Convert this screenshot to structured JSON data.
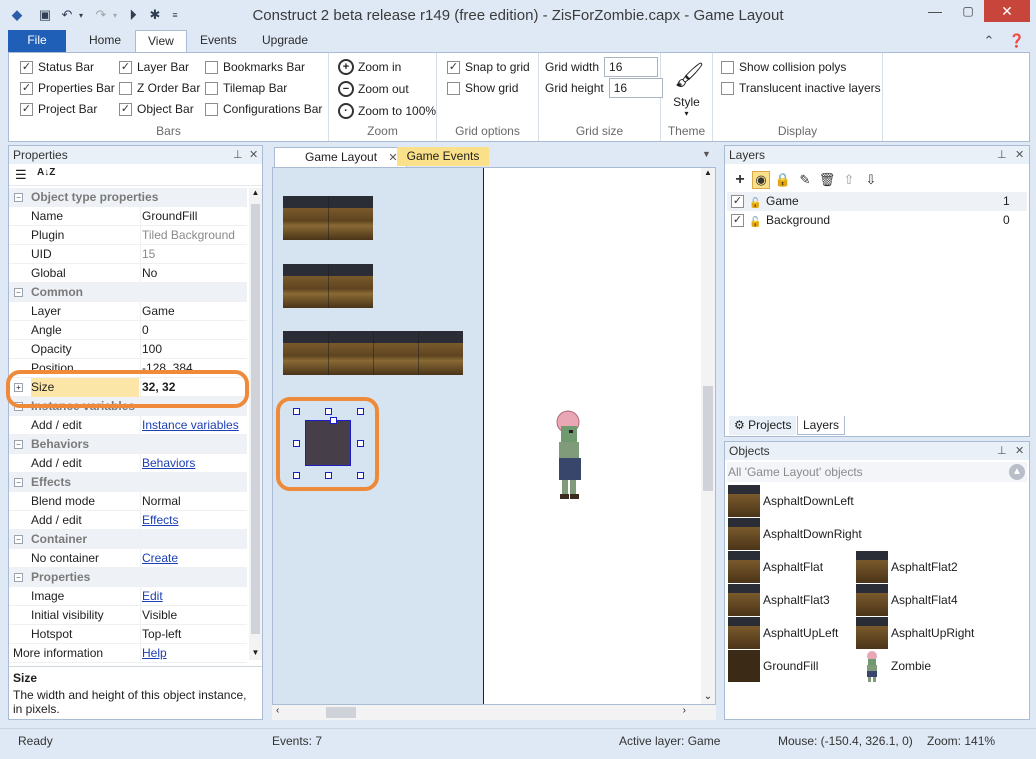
{
  "window": {
    "title": "Construct 2 beta release r149  (free edition) - ZisForZombie.capx - Game Layout",
    "min": "—",
    "max": "▢",
    "close": "✕"
  },
  "quick_access": {
    "icons": [
      "app-icon",
      "save-icon",
      "undo-icon",
      "redo-icon",
      "run-icon",
      "debug-icon",
      "customize-icon"
    ]
  },
  "ribbon_tabs": [
    "File",
    "Home",
    "View",
    "Events",
    "Upgrade"
  ],
  "ribbon": {
    "bars": {
      "label": "Bars",
      "items": [
        {
          "label": "Status Bar",
          "checked": true
        },
        {
          "label": "Properties Bar",
          "checked": true
        },
        {
          "label": "Project Bar",
          "checked": true
        },
        {
          "label": "Layer Bar",
          "checked": true
        },
        {
          "label": "Z Order Bar",
          "checked": false
        },
        {
          "label": "Object Bar",
          "checked": true
        },
        {
          "label": "Bookmarks Bar",
          "checked": false
        },
        {
          "label": "Tilemap Bar",
          "checked": false
        },
        {
          "label": "Configurations Bar",
          "checked": false
        }
      ]
    },
    "zoom": {
      "label": "Zoom",
      "zoom_in": "Zoom in",
      "zoom_out": "Zoom out",
      "zoom_100": "Zoom to 100%"
    },
    "grid_options": {
      "label": "Grid options",
      "snap": "Snap to grid",
      "snap_checked": true,
      "show": "Show grid",
      "show_checked": false
    },
    "grid_size": {
      "label": "Grid size",
      "width_label": "Grid width",
      "width": "16",
      "height_label": "Grid height",
      "height": "16"
    },
    "theme": {
      "label": "Theme",
      "style": "Style"
    },
    "display": {
      "label": "Display",
      "collision": "Show collision polys",
      "translucent": "Translucent inactive layers"
    }
  },
  "properties": {
    "title": "Properties",
    "rows": [
      {
        "type": "cat",
        "k": "Object type properties"
      },
      {
        "type": "row",
        "k": "Name",
        "v": "GroundFill"
      },
      {
        "type": "row",
        "k": "Plugin",
        "v": "Tiled Background",
        "gray": true
      },
      {
        "type": "row",
        "k": "UID",
        "v": "15",
        "gray": true
      },
      {
        "type": "row",
        "k": "Global",
        "v": "No"
      },
      {
        "type": "cat",
        "k": "Common"
      },
      {
        "type": "row",
        "k": "Layer",
        "v": "Game"
      },
      {
        "type": "row",
        "k": "Angle",
        "v": "0"
      },
      {
        "type": "row",
        "k": "Opacity",
        "v": "100"
      },
      {
        "type": "row",
        "k": "Position",
        "v": "-128, 384"
      },
      {
        "type": "sel",
        "k": "Size",
        "v": "32, 32"
      },
      {
        "type": "cat",
        "k": "Instance variables"
      },
      {
        "type": "row",
        "k": "Add / edit",
        "v": "Instance variables",
        "link": true
      },
      {
        "type": "cat",
        "k": "Behaviors"
      },
      {
        "type": "row",
        "k": "Add / edit",
        "v": "Behaviors",
        "link": true
      },
      {
        "type": "cat",
        "k": "Effects"
      },
      {
        "type": "row",
        "k": "Blend mode",
        "v": "Normal"
      },
      {
        "type": "row",
        "k": "Add / edit",
        "v": "Effects",
        "link": true
      },
      {
        "type": "cat",
        "k": "Container"
      },
      {
        "type": "row",
        "k": "No container",
        "v": "Create",
        "link": true
      },
      {
        "type": "cat",
        "k": "Properties"
      },
      {
        "type": "row",
        "k": "Image",
        "v": "Edit",
        "link": true
      },
      {
        "type": "row",
        "k": "Initial visibility",
        "v": "Visible"
      },
      {
        "type": "row",
        "k": "Hotspot",
        "v": "Top-left"
      },
      {
        "type": "row",
        "k": "More information",
        "v": "Help",
        "link": true,
        "nokey": true
      }
    ],
    "desc_title": "Size",
    "desc_text": "The width and height of this object instance, in pixels."
  },
  "editor": {
    "tabs": [
      "Game Layout",
      "Game Events"
    ],
    "tab_close": "✕"
  },
  "layers": {
    "title": "Layers",
    "rows": [
      {
        "name": "Game",
        "num": "1",
        "checked": true
      },
      {
        "name": "Background",
        "num": "0",
        "checked": true
      }
    ],
    "bottom_tabs": [
      "Projects",
      "Layers"
    ]
  },
  "objects": {
    "title": "Objects",
    "filter": "All 'Game Layout' objects",
    "items": [
      "AsphaltDownLeft",
      "AsphaltDownRight",
      "AsphaltFlat",
      "AsphaltFlat2",
      "AsphaltFlat3",
      "AsphaltFlat4",
      "AsphaltUpLeft",
      "AsphaltUpRight",
      "GroundFill",
      "Zombie"
    ]
  },
  "status": {
    "ready": "Ready",
    "events": "Events: 7",
    "active_layer": "Active layer: Game",
    "mouse": "Mouse: (-150.4, 326.1, 0)",
    "zoom": "Zoom: 141%"
  },
  "colors": {
    "accent": "#1f5fb8",
    "highlight": "#ee8a3a",
    "selection": "#fbe6a8",
    "events_tab": "#fbe08a"
  }
}
